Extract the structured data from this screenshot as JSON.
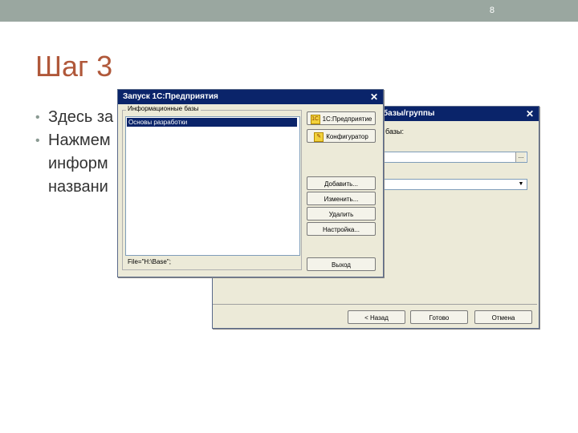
{
  "slide": {
    "number": "8",
    "title": "Шаг 3",
    "bullets": [
      "Здесь за",
      "Нажмем",
      "информ",
      "названи"
    ]
  },
  "back_window": {
    "title": "базы/группы",
    "label": "базы:",
    "buttons": {
      "back": "< Назад",
      "finish": "Готово",
      "cancel": "Отмена"
    }
  },
  "front_window": {
    "title": "Запуск 1С:Предприятия",
    "group_caption": "Информационные базы",
    "list_items": [
      "Основы разработки"
    ],
    "file_path": "File=\"H:\\Base\";",
    "buttons": {
      "enterprise": "1С:Предприятие",
      "configurator": "Конфигуратор",
      "add": "Добавить...",
      "edit": "Изменить...",
      "delete": "Удалить",
      "settings": "Настройка...",
      "exit": "Выход"
    }
  },
  "colors": {
    "title_color": "#b0583a",
    "topbar": "#9aa7a0",
    "window_title_bar": "#0a246a"
  }
}
